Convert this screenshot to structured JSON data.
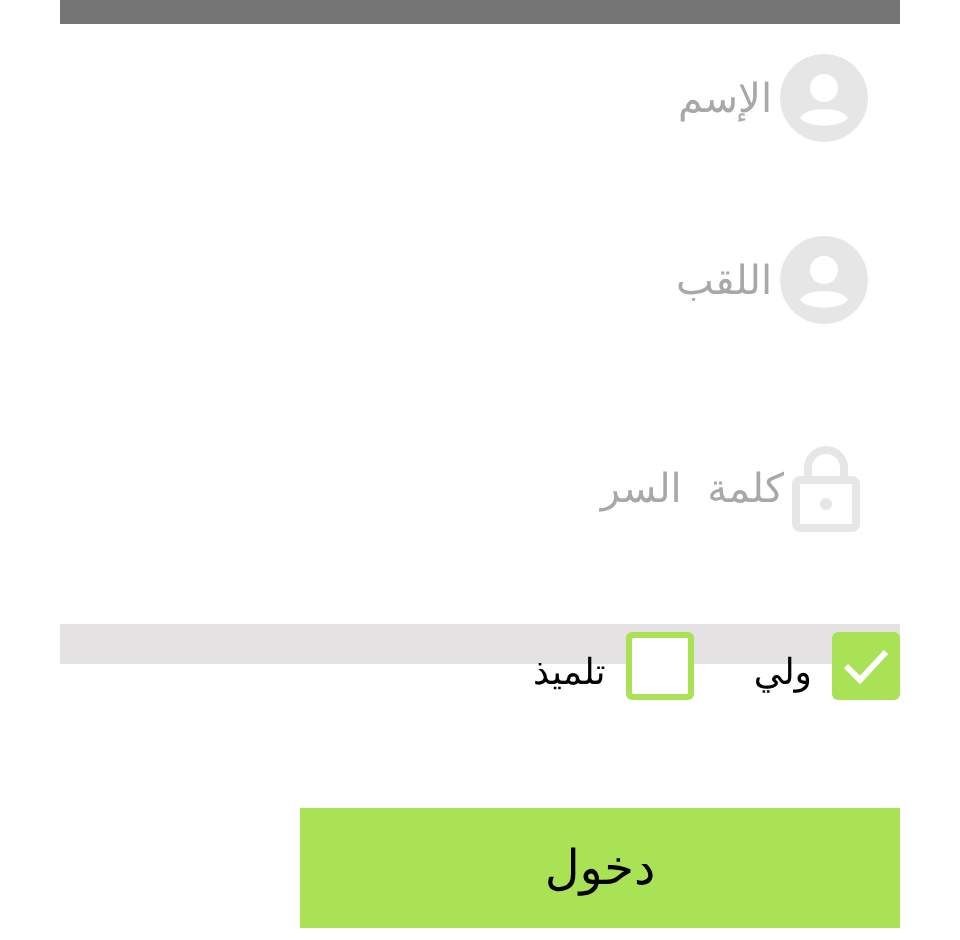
{
  "fields": [
    {
      "kind": "person",
      "placeholder": "الإسم"
    },
    {
      "kind": "person",
      "placeholder": "اللقب"
    },
    {
      "kind": "lock",
      "placeholder": "كلمة  السر"
    }
  ],
  "roles": [
    {
      "label": "ولي",
      "checked": true
    },
    {
      "label": "تلميذ",
      "checked": false
    }
  ],
  "login_button": "دخول"
}
